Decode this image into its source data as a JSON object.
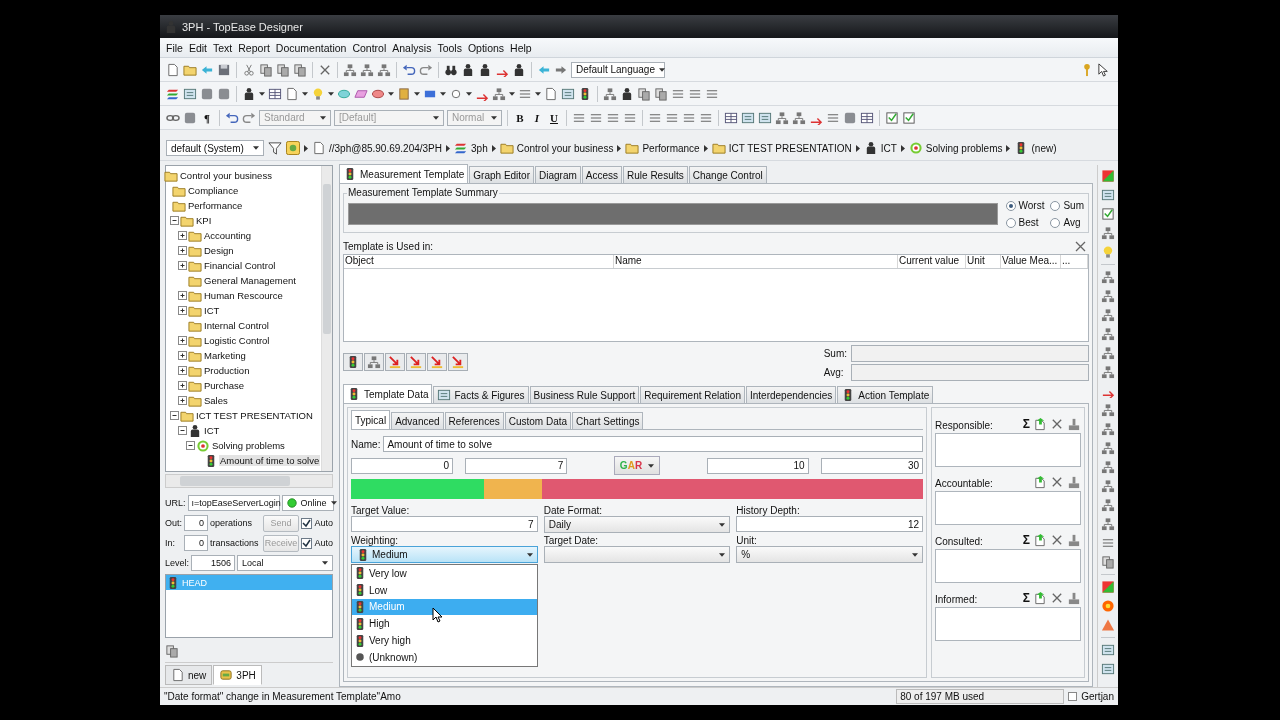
{
  "window": {
    "title": "3PH - TopEase Designer"
  },
  "menu": [
    "File",
    "Edit",
    "Text",
    "Report",
    "Documentation",
    "Control",
    "Analysis",
    "Tools",
    "Options",
    "Help"
  ],
  "toolbar": {
    "language": "Default Language",
    "paragraph_mark": "¶",
    "style": "Standard",
    "font": "[Default]",
    "size": "Normal",
    "format_disabled": true,
    "text_styles": [
      "B",
      "I",
      "U"
    ]
  },
  "breadcrumb": {
    "view": "default (System)",
    "path": [
      {
        "label": "//3ph@85.90.69.204/3PH",
        "kind": "doc"
      },
      {
        "label": "3ph",
        "kind": "layers"
      },
      {
        "label": "Control your business",
        "kind": "folder"
      },
      {
        "label": "Performance",
        "kind": "folder"
      },
      {
        "label": "ICT TEST PRESENTATION",
        "kind": "folder"
      },
      {
        "label": "ICT",
        "kind": "role"
      },
      {
        "label": "Solving problems",
        "kind": "goal"
      },
      {
        "label": "(new)",
        "kind": "measure"
      }
    ]
  },
  "tree": {
    "items": [
      {
        "label": "Control your business",
        "kind": "folder",
        "selected": false,
        "children": [
          {
            "label": "Compliance",
            "kind": "folder",
            "selected": false
          },
          {
            "label": "Performance",
            "kind": "folder",
            "selected": false,
            "children": [
              {
                "label": "KPI",
                "kind": "folder",
                "selected": false,
                "expanded": true,
                "children": [
                  {
                    "label": "Accounting",
                    "kind": "folder",
                    "selected": false,
                    "expanded": false
                  },
                  {
                    "label": "Design",
                    "kind": "folder",
                    "selected": false,
                    "expanded": false
                  },
                  {
                    "label": "Financial Control",
                    "kind": "folder",
                    "selected": false,
                    "expanded": false
                  },
                  {
                    "label": "General Management",
                    "kind": "folder",
                    "selected": false
                  },
                  {
                    "label": "Human Rescource",
                    "kind": "folder",
                    "selected": false,
                    "expanded": false
                  },
                  {
                    "label": "ICT",
                    "kind": "folder",
                    "selected": false,
                    "expanded": false
                  },
                  {
                    "label": "Internal Control",
                    "kind": "folder",
                    "selected": false
                  },
                  {
                    "label": "Logistic Control",
                    "kind": "folder",
                    "selected": false,
                    "expanded": false
                  },
                  {
                    "label": "Marketing",
                    "kind": "folder",
                    "selected": false,
                    "expanded": false
                  },
                  {
                    "label": "Production",
                    "kind": "folder",
                    "selected": false,
                    "expanded": false
                  },
                  {
                    "label": "Purchase",
                    "kind": "folder",
                    "selected": false,
                    "expanded": false
                  },
                  {
                    "label": "Sales",
                    "kind": "folder",
                    "selected": false,
                    "expanded": false
                  }
                ]
              },
              {
                "label": "ICT TEST PRESENTATION",
                "kind": "folder",
                "selected": false,
                "expanded": true,
                "children": [
                  {
                    "label": "ICT",
                    "kind": "role",
                    "selected": false,
                    "expanded": true,
                    "children": [
                      {
                        "label": "Solving problems",
                        "kind": "goal",
                        "selected": false,
                        "expanded": true,
                        "children": [
                          {
                            "label": "Amount of time to solve",
                            "kind": "measure",
                            "selected": true
                          }
                        ]
                      }
                    ]
                  }
                ]
              }
            ]
          }
        ]
      }
    ]
  },
  "sync": {
    "url_label": "URL:",
    "url": "ı=topEaseServerLogin",
    "status": "Online",
    "rows": [
      {
        "label": "Out:",
        "value": "0",
        "unit": "operations",
        "button": "Send",
        "button_disabled": true,
        "auto": "Auto",
        "auto_checked": true
      },
      {
        "label": "In:",
        "value": "0",
        "unit": "transactions",
        "button": "Receive",
        "button_disabled": true,
        "auto": "Auto",
        "auto_checked": true
      }
    ],
    "level_label": "Level:",
    "level_value": "1506",
    "mode": "Local",
    "list": [
      {
        "label": "HEAD",
        "selected": true
      }
    ]
  },
  "bottom_tabs": [
    {
      "label": "new",
      "kind": "doc",
      "selected": false
    },
    {
      "label": "3PH",
      "kind": "server",
      "selected": true
    }
  ],
  "tabs": [
    {
      "label": "Measurement Template",
      "selected": true
    },
    {
      "label": "Graph Editor",
      "selected": false
    },
    {
      "label": "Diagram",
      "selected": false
    },
    {
      "label": "Access",
      "selected": false
    },
    {
      "label": "Rule Results",
      "selected": false
    },
    {
      "label": "Change Control",
      "selected": false
    }
  ],
  "summary": {
    "title": "Measurement Template Summary",
    "options": [
      {
        "label": "Worst",
        "selected": true
      },
      {
        "label": "Sum",
        "selected": false
      },
      {
        "label": "Best",
        "selected": false
      },
      {
        "label": "Avg",
        "selected": false
      }
    ]
  },
  "usage": {
    "title": "Template is Used in:",
    "columns": [
      "Object",
      "Name",
      "Current value",
      "Unit",
      "Value Mea...",
      "..."
    ],
    "sum_label": "Sum:",
    "avg_label": "Avg:"
  },
  "sub_tabs": [
    {
      "label": "Template Data",
      "selected": true
    },
    {
      "label": "Facts & Figures",
      "selected": false
    },
    {
      "label": "Business Rule Support",
      "selected": false
    },
    {
      "label": "Requirement Relation",
      "selected": false
    },
    {
      "label": "Interdependencies",
      "selected": false
    },
    {
      "label": "Action Template",
      "selected": false
    }
  ],
  "inner_tabs": [
    {
      "label": "Typical",
      "selected": true
    },
    {
      "label": "Advanced",
      "selected": false
    },
    {
      "label": "References",
      "selected": false
    },
    {
      "label": "Custom Data",
      "selected": false
    },
    {
      "label": "Chart Settings",
      "selected": false
    }
  ],
  "form": {
    "name_label": "Name:",
    "name": "Amount of time to solve",
    "thresholds": [
      "0",
      "7",
      "10",
      "30"
    ],
    "scale_type": "GAR",
    "scale_bar": [
      {
        "color": "#2fdc62"
      },
      {
        "color": "#f0b44e"
      },
      {
        "color": "#e05870"
      }
    ],
    "fields": [
      {
        "label": "Target Value:",
        "kind": "text",
        "value": "7"
      },
      {
        "label": "Date Format:",
        "kind": "select",
        "value": "Daily",
        "expanded": false
      },
      {
        "label": "History Depth:",
        "kind": "text",
        "value": "12"
      },
      {
        "label": "Weighting:",
        "kind": "level-select",
        "value": "Medium",
        "expanded": true,
        "options": [
          {
            "label": "Very low",
            "kind": "level",
            "selected": false
          },
          {
            "label": "Low",
            "kind": "level",
            "selected": false
          },
          {
            "label": "Medium",
            "kind": "level",
            "selected": true
          },
          {
            "label": "High",
            "kind": "level",
            "selected": false
          },
          {
            "label": "Very high",
            "kind": "level",
            "selected": false
          },
          {
            "label": "(Unknown)",
            "kind": "unknown",
            "selected": false
          }
        ]
      },
      {
        "label": "Target Date:",
        "kind": "select",
        "expanded": false
      },
      {
        "label": "Unit:",
        "kind": "select",
        "value": "%",
        "expanded": false
      }
    ]
  },
  "raci": [
    {
      "label": "Responsible:",
      "sum": "Σ"
    },
    {
      "label": "Accountable:"
    },
    {
      "label": "Consulted:",
      "sum": "Σ"
    },
    {
      "label": "Informed:",
      "sum": "Σ"
    }
  ],
  "status_bar": {
    "message": "\"Date format\" change in Measurement Template\"Amo",
    "memory": "80 of 197 MB used",
    "user": "Gertjan"
  }
}
